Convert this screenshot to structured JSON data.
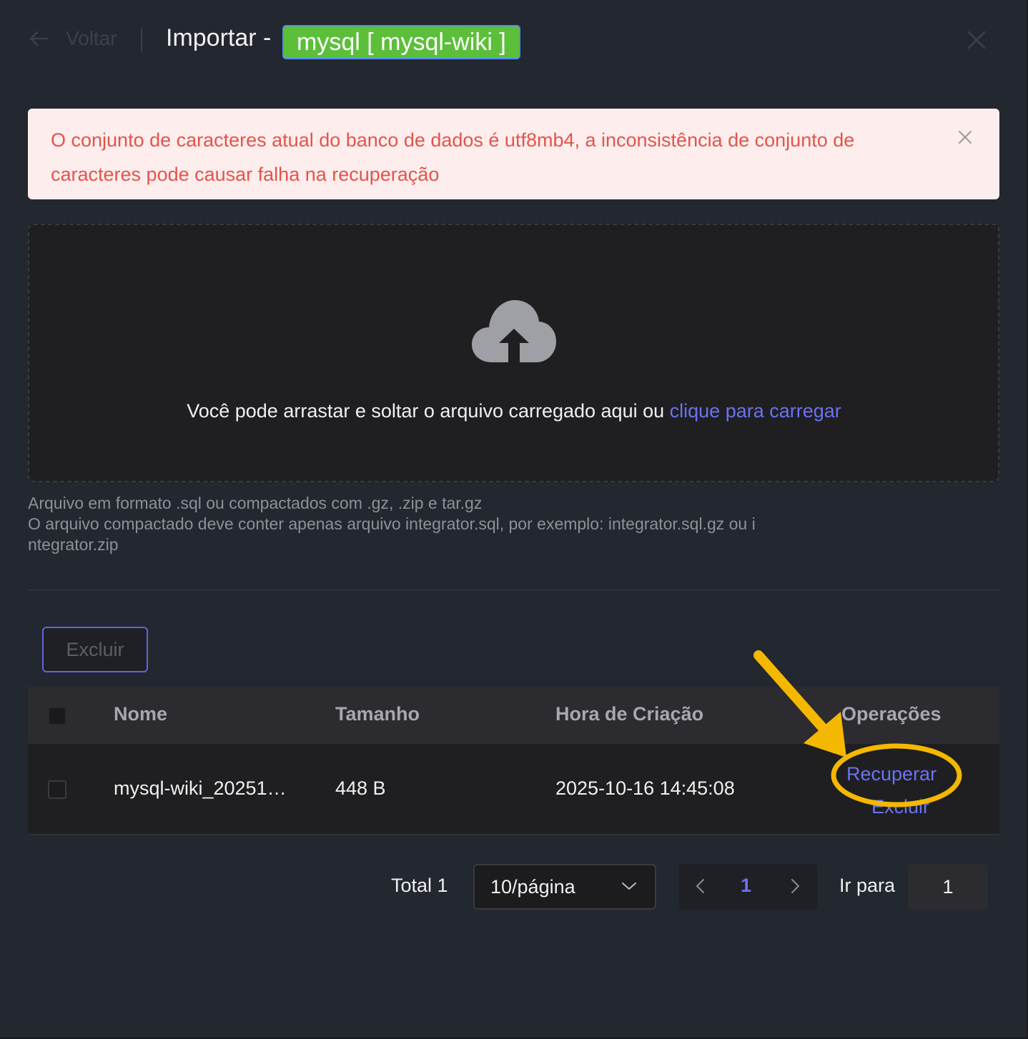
{
  "header": {
    "back_label": "Voltar",
    "title": "Importar -",
    "tag": "mysql [ mysql-wiki ]"
  },
  "alert": {
    "message": "O conjunto de caracteres atual do banco de dados é utf8mb4, a inconsistência de conjunto de caracteres pode causar falha na recuperação"
  },
  "upload": {
    "text": "Você pode arrastar e soltar o arquivo carregado aqui ou",
    "link": "clique para carregar",
    "hint_line1": "Arquivo em formato .sql ou compactados com .gz, .zip e tar.gz",
    "hint_line2": "O arquivo compactado deve conter apenas arquivo integrator.sql, por exemplo: integrator.sql.gz ou i",
    "hint_line3": "ntegrator.zip"
  },
  "toolbar": {
    "delete_label": "Excluir"
  },
  "table": {
    "columns": [
      "Nome",
      "Tamanho",
      "Hora de Criação",
      "Operações"
    ],
    "rows": [
      {
        "name": "mysql-wiki_20251…",
        "size": "448 B",
        "created": "2025-10-16 14:45:08",
        "op_recover": "Recuperar",
        "op_delete": "Excluir"
      }
    ]
  },
  "pagination": {
    "total": "Total 1",
    "page_size": "10/página",
    "current_page": "1",
    "goto_label": "Ir para",
    "goto_value": "1"
  },
  "colors": {
    "accent": "#6a72f2",
    "tag_bg": "#5cbf3a",
    "alert_bg": "#fdeeed",
    "alert_text": "#e5534b",
    "annotation": "#f5b800"
  }
}
